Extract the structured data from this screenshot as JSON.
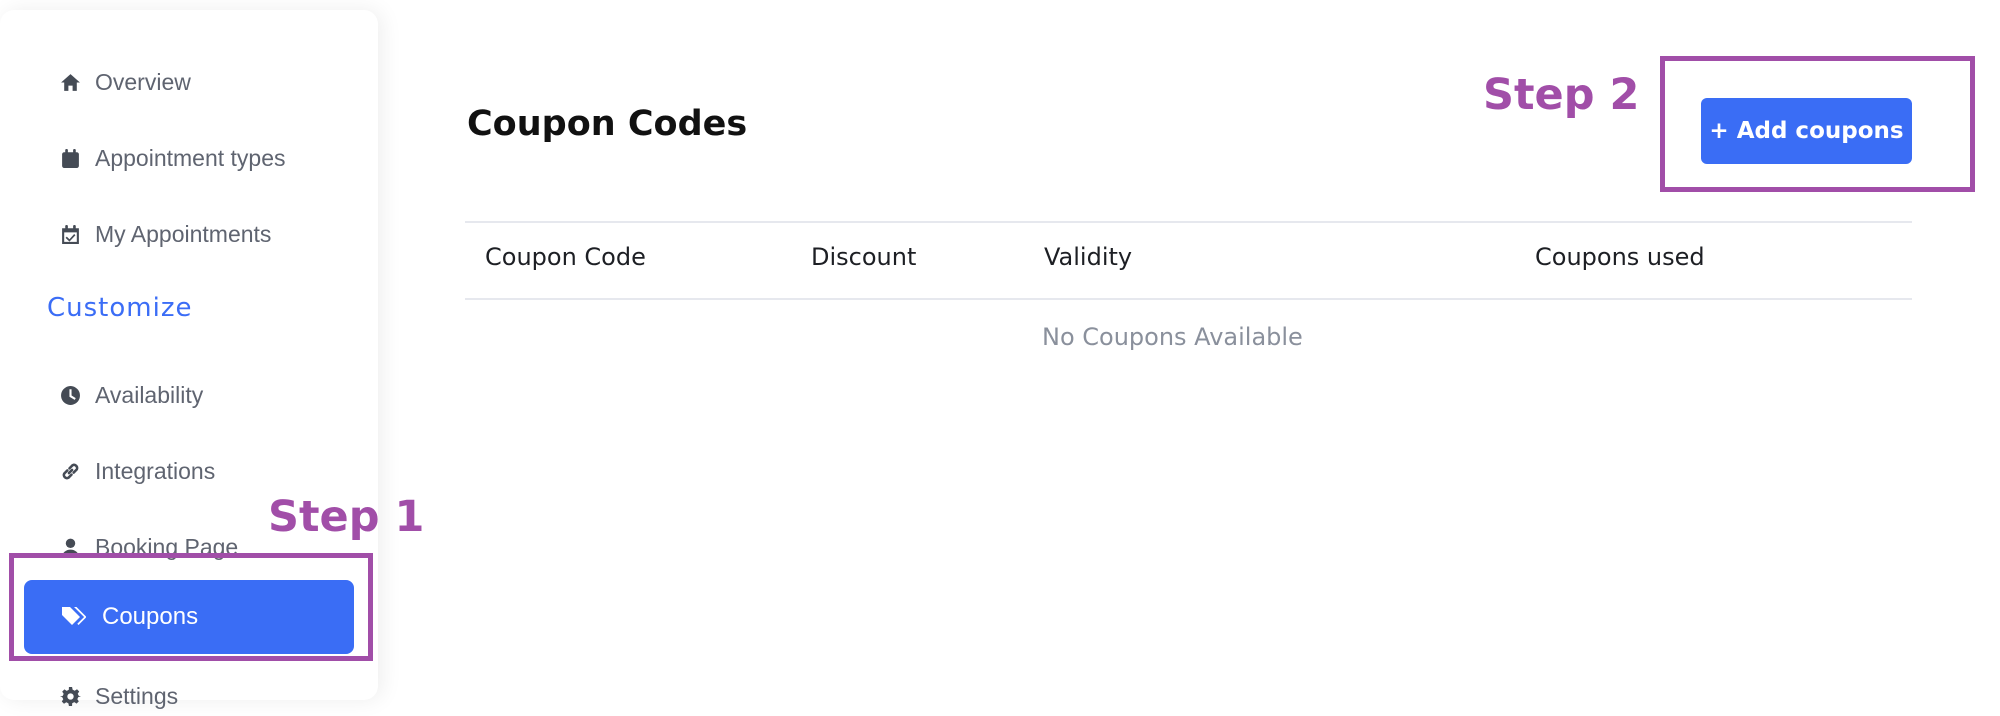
{
  "sidebar": {
    "items": [
      {
        "label": "Overview",
        "icon": "home-icon"
      },
      {
        "label": "Appointment types",
        "icon": "calendar-icon"
      },
      {
        "label": "My Appointments",
        "icon": "calendar-check-icon"
      }
    ],
    "section_title": "Customize",
    "customize_items": [
      {
        "label": "Availability",
        "icon": "clock-icon"
      },
      {
        "label": "Integrations",
        "icon": "link-icon"
      },
      {
        "label": "Booking Page",
        "icon": "user-icon"
      },
      {
        "label": "Coupons",
        "icon": "tags-icon",
        "active": true
      },
      {
        "label": "Settings",
        "icon": "gear-icon"
      }
    ]
  },
  "main": {
    "title": "Coupon Codes",
    "add_button_label": "+ Add coupons",
    "table": {
      "columns": [
        "Coupon Code",
        "Discount",
        "Validity",
        "Coupons used"
      ],
      "empty_text": "No Coupons Available"
    }
  },
  "annotations": {
    "step1": "Step 1",
    "step2": "Step 2"
  },
  "colors": {
    "accent": "#3a6df5",
    "annotation": "#a14ea8",
    "section_title": "#3b6df6"
  }
}
